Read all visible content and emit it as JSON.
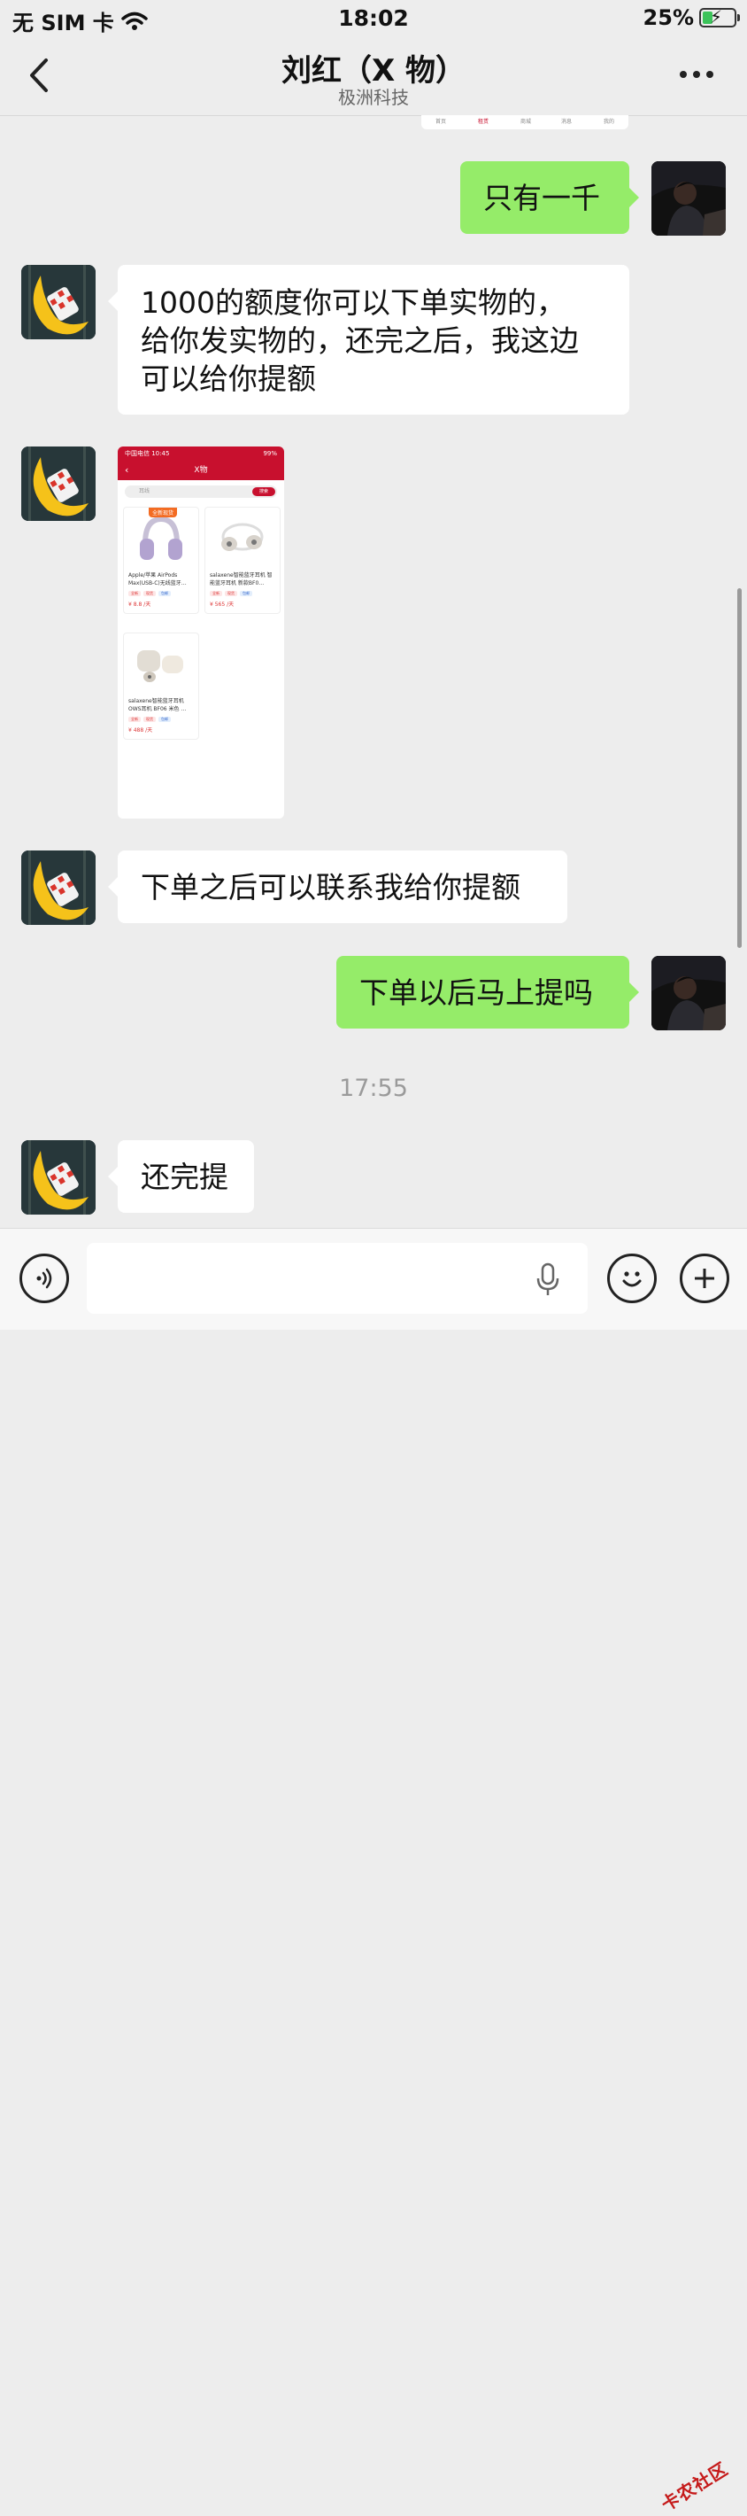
{
  "status_bar": {
    "carrier": "无 SIM 卡",
    "time": "18:02",
    "battery_percent": "25%"
  },
  "nav": {
    "title": "刘红（X 物）",
    "subtitle": "极洲科技",
    "back_icon": "chevron-left-icon",
    "more_icon": "ellipsis-icon"
  },
  "messages": [
    {
      "side": "right",
      "text": "只有一千"
    },
    {
      "side": "left",
      "lines": [
        "1000的额度你可以下单实物的，",
        "给你发实物的，还完之后，我这边",
        "可以给你提额"
      ]
    },
    {
      "side": "left",
      "type": "image"
    },
    {
      "side": "left",
      "text": "下单之后可以联系我给你提额"
    },
    {
      "side": "right",
      "text": "下单以后马上提吗"
    },
    {
      "side": "left",
      "text": "还完提"
    }
  ],
  "timestamp": "17:55",
  "shared_image": {
    "status_left": "中国电信 10:45",
    "status_right": "99%",
    "header_title": "X物",
    "search_placeholder": "耳线",
    "search_button": "搜索",
    "badge": "全新现货",
    "products": [
      {
        "title": "Apple/苹果 AirPods Max(USB-C)无线蓝牙…",
        "tags": [
          "全新",
          "现货",
          "包邮"
        ],
        "price": "¥ 8.8 /天"
      },
      {
        "title": "salaxene智能蓝牙耳机 智能蓝牙耳机 新款BF0…",
        "tags": [
          "全新",
          "现货",
          "包邮"
        ],
        "price": "¥ 565 /天"
      },
      {
        "title": "salaxene智能蓝牙耳机 OWS耳机 BF06 米色 …",
        "tags": [
          "全新",
          "现货",
          "包邮"
        ],
        "price": "¥ 488 /天"
      }
    ],
    "remnant_tabs": [
      "首页",
      "租赁",
      "商城",
      "消息",
      "我的"
    ]
  },
  "input_bar": {
    "voice_icon": "voice-icon",
    "mic_icon": "microphone-icon",
    "emoji_icon": "emoji-icon",
    "plus_icon": "plus-icon",
    "watermark": "卡农社区"
  },
  "colors": {
    "background": "#ededed",
    "my_bubble": "#95ec69",
    "their_bubble": "#ffffff",
    "accent_red": "#c8102e"
  }
}
